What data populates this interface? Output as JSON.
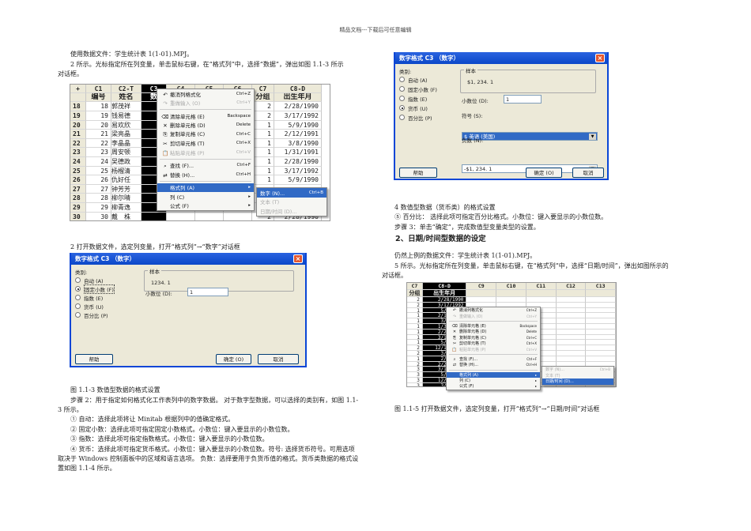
{
  "header": "精品文档---下载后可任意编辑",
  "left": {
    "p1": "使用数据文件：学生统计表 1(1-01).MPJ。",
    "p2a": "2 所示。光标指定所在列变量，单击鼠标右键，在“格式列”中，选择“数据”，弹出如图 1.1-3 所示",
    "p2b": "对话框。",
    "caption2": "2 打开数据文件，选定列变量，打开“格式列”→“数字”对话框",
    "fig3": "图 1.1-3 数值型数据的格式设置",
    "step2a": "步骤 2：用于指定如何格式化工作表列中的数字数据。 对于数字型数据，可以选择的类别有，如图 1.1-",
    "step2b": "3 所示。",
    "i1": "① 自动：选择此项将让  Minitab 根据列中的值确定格式。",
    "i2": "② 固定小数：选择此项可指定固定小数格式。小数位：键入要显示的小数位数。",
    "i3": "③ 指数：选择此项可指定指数格式。小数位：键入要显示的小数位数。",
    "i4a": "④ 货币：选择此项可指定货币格式。小数位：键入要显示的小数位数。符号: 选择货币符号。可用选项",
    "i4b": "取决于  Windows 控制面板中的区域和语言选项。  负数：选择要用于负货币值的格式。货币类数据的格式设",
    "i4c": "置如图 1.1-4 所示。"
  },
  "sheet1": {
    "cols": [
      "+",
      "C1",
      "C2-T",
      "C3",
      "C4",
      "C5",
      "C6",
      "C7",
      "C8-D"
    ],
    "names": [
      "",
      "编号",
      "姓名",
      "数",
      "",
      "",
      "",
      "分组",
      "出生年月"
    ],
    "rows": [
      [
        "18",
        "18",
        "郭茂祥",
        "",
        "",
        "",
        "",
        "2",
        "2/28/1990"
      ],
      [
        "19",
        "19",
        "钱易德",
        "",
        "",
        "",
        "",
        "2",
        "3/17/1992"
      ],
      [
        "20",
        "20",
        "易欢欣",
        "",
        "",
        "",
        "",
        "1",
        "5/9/1990"
      ],
      [
        "21",
        "21",
        "梁亮晶",
        "",
        "",
        "",
        "",
        "1",
        "2/12/1991"
      ],
      [
        "22",
        "22",
        "李晶晶",
        "",
        "",
        "",
        "",
        "1",
        "3/8/1990"
      ],
      [
        "23",
        "23",
        "周安顿",
        "",
        "",
        "",
        "",
        "1",
        "1/31/1991"
      ],
      [
        "24",
        "24",
        "吴德政",
        "",
        "",
        "",
        "",
        "1",
        "2/28/1990"
      ],
      [
        "25",
        "25",
        "杨榴清",
        "",
        "",
        "",
        "",
        "1",
        "3/17/1992"
      ],
      [
        "26",
        "26",
        "仇好任",
        "",
        "",
        "",
        "",
        "1",
        "5/9/1990"
      ],
      [
        "27",
        "27",
        "钟芳芳",
        "",
        "",
        "",
        "",
        "",
        ""
      ],
      [
        "28",
        "28",
        "柳尔晴",
        "",
        "",
        "",
        "",
        "",
        ""
      ],
      [
        "29",
        "29",
        "柳青逸",
        "",
        "",
        "",
        "",
        "",
        ""
      ],
      [
        "30",
        "30",
        "戴　株",
        "",
        "",
        "",
        "",
        "2",
        "2/28/1990"
      ]
    ]
  },
  "menu": [
    {
      "icon": "undo",
      "label": "撤消列格式化",
      "key": "Ctrl+Z",
      "state": ""
    },
    {
      "icon": "redo",
      "label": "重做输入 (O)",
      "key": "Ctrl+Y",
      "state": "dis"
    },
    {
      "sep": true
    },
    {
      "icon": "eraser",
      "label": "清除单元格 (E)",
      "key": "Backspace",
      "state": ""
    },
    {
      "icon": "delete",
      "label": "删除单元格 (D)",
      "key": "Delete",
      "state": ""
    },
    {
      "icon": "copy",
      "label": "复制单元格 (C)",
      "key": "Ctrl+C",
      "state": ""
    },
    {
      "icon": "cut",
      "label": "剪切单元格 (T)",
      "key": "Ctrl+X",
      "state": ""
    },
    {
      "icon": "paste",
      "label": "粘贴单元格 (P)",
      "key": "Ctrl+V",
      "state": "dis"
    },
    {
      "sep": true
    },
    {
      "icon": "find",
      "label": "查找 (F)...",
      "key": "Ctrl+F",
      "state": ""
    },
    {
      "icon": "replace",
      "label": "替换 (H)...",
      "key": "Ctrl+H",
      "state": ""
    },
    {
      "sep": true
    },
    {
      "icon": "",
      "label": "格式列 (A)",
      "key": "▸",
      "state": "hl"
    },
    {
      "icon": "",
      "label": "列 (C)",
      "key": "▸",
      "state": ""
    },
    {
      "icon": "",
      "label": "公式 (F)",
      "key": "▸",
      "state": ""
    }
  ],
  "submenu1": [
    {
      "label": "数字 (N)...",
      "key": "Ctrl+B",
      "state": "hl"
    },
    {
      "label": "文本 (T)",
      "key": "",
      "state": "dis"
    },
    {
      "label": "日期/时间 (D)...",
      "key": "",
      "state": "dis"
    }
  ],
  "dialog1": {
    "title": "数字格式 C3 （数字）",
    "category_label": "类别:",
    "options": [
      "自动 (A)",
      "固定小数 (F)",
      "指数 (E)",
      "货币 (U)",
      "百分比 (P)"
    ],
    "selected": 1,
    "sample_label": "样本",
    "sample": "1234. 1",
    "decimals_label": "小数位 (D):",
    "decimals": "1",
    "help": "帮助",
    "ok": "确定 (O)",
    "cancel": "取消"
  },
  "dialog2": {
    "title": "数字格式 C3 （数字）",
    "category_label": "类别:",
    "options": [
      "自动 (A)",
      "固定小数 (F)",
      "指数 (E)",
      "货币 (U)",
      "百分比 (P)"
    ],
    "selected": 3,
    "sample_label": "样本",
    "sample": "$1, 234. 1",
    "decimals_label": "小数位 (D):",
    "decimals": "1",
    "symbol_label": "符号 (S):",
    "symbol": "$ 英语 (美国)",
    "negative_label": "负数 (N):",
    "negative": "-$1, 234. 1",
    "help": "帮助",
    "ok": "确定 (O)",
    "cancel": "取消"
  },
  "right": {
    "fig4": "4 数值型数据（货币类）的格式设置",
    "i5": "⑤ 百分比：  选择此项可指定百分比格式。小数位：键入要显示的小数位数。",
    "step3": "步骤 3：单击“确定”，完成数值型变量类型的设置。",
    "heading": "2、日期/时间型数据的设定",
    "p1": "仍然上例的数据文件：学生统计表 1(1-01).MPJ。",
    "p2a": "5 所示。光标指定所在列变量，单击鼠标右键，在“格式列”中，选择“日期/时间”，弹出如图所示的",
    "p2b": "对话框。",
    "fig5": "图 1.1-5  打开数据文件，选定列变量，打开“格式列”→“日期/时间”对话框"
  },
  "sheet2": {
    "cols": [
      "C7",
      "C8-D",
      "C9",
      "C10",
      "C11",
      "C12",
      "C13"
    ],
    "names": [
      "分组",
      "出生年月",
      "",
      "",
      "",
      "",
      ""
    ],
    "rows": [
      [
        "2",
        "2/28/1990"
      ],
      [
        "2",
        "3/17/1992"
      ],
      [
        "1",
        "5/9/1990"
      ],
      [
        "1",
        "2/12/1991"
      ],
      [
        "1",
        "3/8/1990"
      ],
      [
        "1",
        "1/31/1991"
      ],
      [
        "1",
        "2/28/1990"
      ],
      [
        "1",
        "3/17/1992"
      ],
      [
        "1",
        "5/9/1990"
      ],
      [
        "2",
        "12/12/1991"
      ],
      [
        "2",
        "3/8/1990"
      ],
      [
        "1",
        "2/3/1991"
      ],
      [
        "2",
        "2/28/1990"
      ],
      [
        "3",
        "3/17/1992"
      ],
      [
        "3",
        "5/9/1990"
      ],
      [
        "3",
        "12/2/1990"
      ],
      [
        "3",
        "3/8/1991"
      ]
    ]
  },
  "submenu2": [
    {
      "label": "数字 (N)...",
      "key": "Ctrl+B",
      "state": "dis"
    },
    {
      "label": "文本 (T)",
      "key": "",
      "state": "dis"
    },
    {
      "label": "日期/时间 (D)...",
      "key": "",
      "state": "hl"
    }
  ]
}
